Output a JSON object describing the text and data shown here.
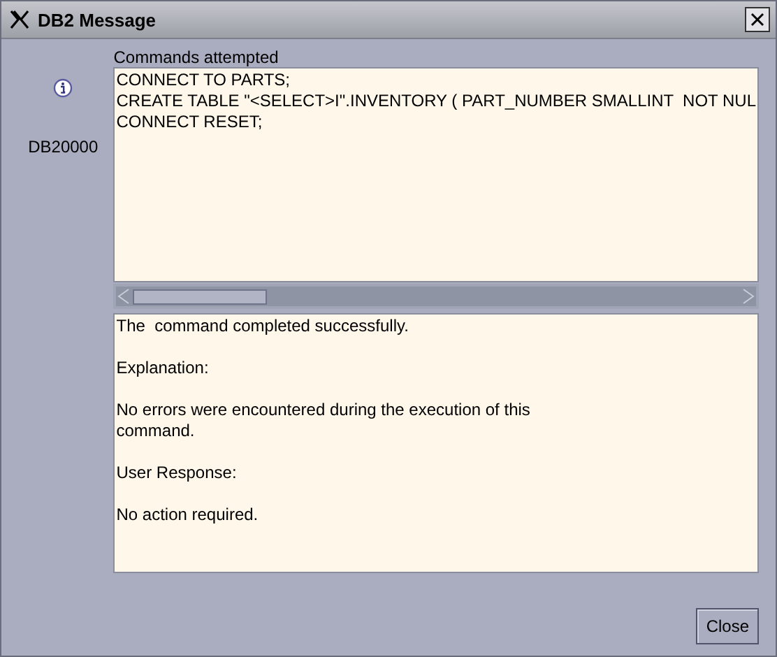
{
  "window": {
    "title": "DB2 Message"
  },
  "message": {
    "code": "DB20000"
  },
  "commands": {
    "label": "Commands attempted",
    "lines": [
      "CONNECT TO PARTS;",
      "CREATE TABLE \"<SELECT>I\".INVENTORY ( PART_NUMBER SMALLINT  NOT NUL",
      "CONNECT RESET;"
    ]
  },
  "details": {
    "paragraphs": [
      {
        "lines": [
          "The  command completed successfully."
        ]
      },
      {
        "lines": [
          "Explanation:"
        ]
      },
      {
        "lines": [
          "No errors were encountered during the execution of this",
          "command."
        ]
      },
      {
        "lines": [
          "User Response:"
        ]
      },
      {
        "lines": [
          "No action required."
        ]
      }
    ]
  },
  "buttons": [
    {
      "label": "Close"
    }
  ]
}
